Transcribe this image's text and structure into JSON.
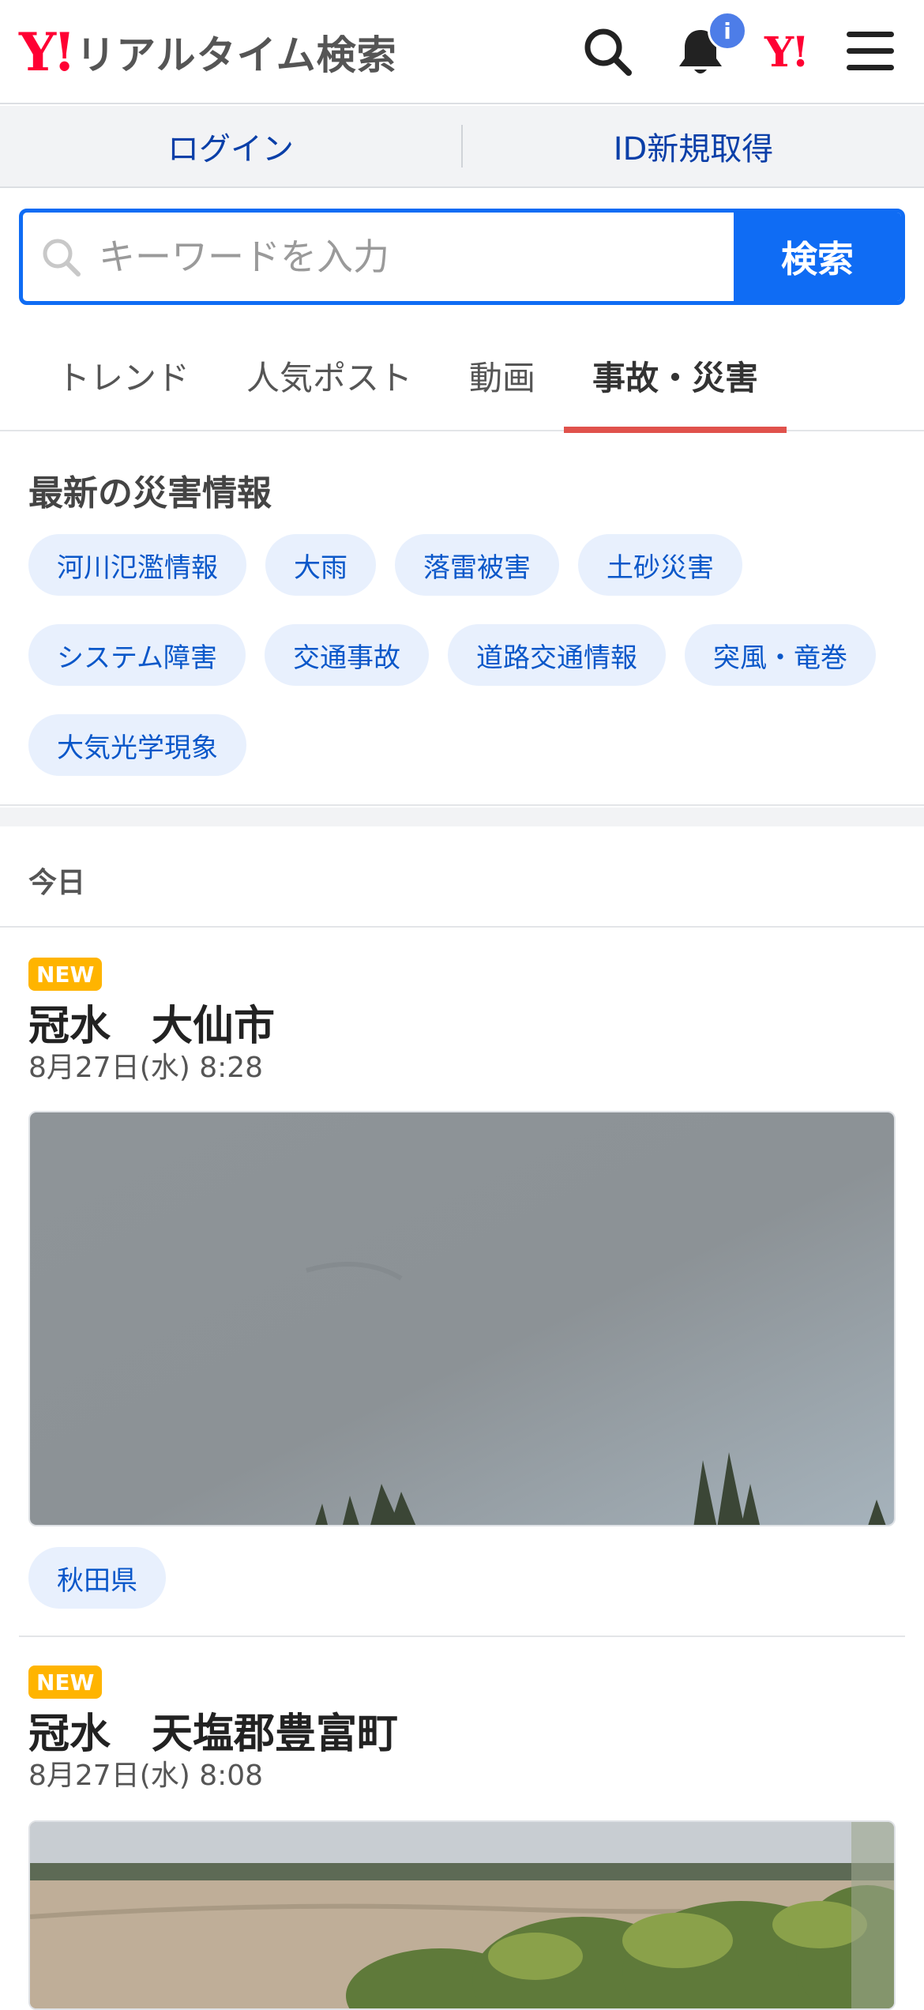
{
  "header": {
    "logo_mark": "Y!",
    "logo_text": "リアルタイム検索",
    "notification_badge": "i",
    "yj_mark": "Y!"
  },
  "account": {
    "login_label": "ログイン",
    "register_label": "ID新規取得"
  },
  "search": {
    "placeholder": "キーワードを入力",
    "button_label": "検索"
  },
  "tabs": [
    {
      "label": "トレンド",
      "active": false
    },
    {
      "label": "人気ポスト",
      "active": false
    },
    {
      "label": "動画",
      "active": false
    },
    {
      "label": "事故・災害",
      "active": true
    }
  ],
  "disaster": {
    "title": "最新の災害情報",
    "chips": [
      "河川氾濫情報",
      "大雨",
      "落雷被害",
      "土砂災害",
      "システム障害",
      "交通事故",
      "道路交通情報",
      "突風・竜巻",
      "大気光学現象"
    ]
  },
  "today_label": "今日",
  "articles": [
    {
      "badge": "NEW",
      "title": "冠水　大仙市",
      "time": "8月27日(水) 8:28",
      "tag": "秋田県"
    },
    {
      "badge": "NEW",
      "title": "冠水　天塩郡豊富町",
      "time": "8月27日(水) 8:08"
    }
  ],
  "colors": {
    "accent_blue": "#0f6cf4",
    "brand_red": "#ff0033",
    "tab_indicator": "#e0524c",
    "new_badge": "#ffb400"
  }
}
